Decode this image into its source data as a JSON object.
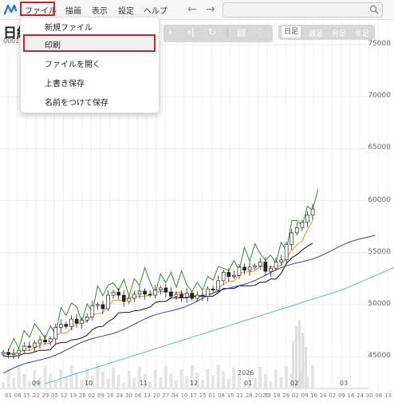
{
  "menubar": {
    "items": [
      {
        "label": "ファイル"
      },
      {
        "label": "描画"
      },
      {
        "label": "表示"
      },
      {
        "label": "設定"
      },
      {
        "label": "ヘルプ"
      }
    ],
    "back_icon": "arrow-left-icon",
    "forward_icon": "arrow-right-icon",
    "search_placeholder": ""
  },
  "symbol": {
    "title": "日経",
    "code": "0001"
  },
  "toolbar": {
    "icons": [
      "chevron-right-icon",
      "skip-to-end-icon",
      "refresh-icon",
      "list-panel-icon",
      "favorite-add-icon"
    ]
  },
  "period_buttons": [
    {
      "label": "日足",
      "active": true
    },
    {
      "label": "週足",
      "active": false
    },
    {
      "label": "月足",
      "active": false
    },
    {
      "label": "年足",
      "active": false
    }
  ],
  "file_menu": {
    "items": [
      {
        "label": "新規ファイル"
      },
      {
        "label": "印刷",
        "highlighted": true
      },
      {
        "label": "ファイルを開く"
      },
      {
        "label": "上書き保存"
      },
      {
        "label": "名前をつけて保存"
      }
    ]
  },
  "colors": {
    "highlight": "#d0202a",
    "candle": "#222222",
    "conversion_line": "#f08c28",
    "base_line": "#111111",
    "lagging_span": "#2e8b2e",
    "leading_span_a": "#5ab4e6",
    "leading_span_b": "#3a3ab0"
  },
  "chart_data": {
    "type": "candlestick",
    "overlay": "ichimoku",
    "y_ticks": [
      45000,
      50000,
      55000,
      60000,
      65000,
      70000,
      75000
    ],
    "ylim": [
      43000,
      76000
    ],
    "x_tick_labels": [
      "01",
      "08",
      "15",
      "22",
      "29",
      "05",
      "12",
      "19",
      "26",
      "02",
      "09",
      "16",
      "24",
      "30",
      "06",
      "13",
      "20",
      "27",
      "04",
      "10",
      "17",
      "25",
      "01",
      "08",
      "15",
      "21",
      "28",
      "2025",
      "13",
      "19",
      "26",
      "02",
      "09",
      "16",
      "24",
      "02",
      "09",
      "16",
      "24",
      "30",
      "06",
      "13"
    ],
    "month_labels": [
      "09",
      "10",
      "11",
      "12",
      "2026",
      "01",
      "02",
      "03"
    ],
    "closes": [
      45400,
      45200,
      45300,
      45600,
      46000,
      45900,
      46300,
      46600,
      46400,
      46700,
      47800,
      48100,
      47900,
      48600,
      48200,
      48500,
      48800,
      49900,
      50000,
      49600,
      50900,
      51200,
      50900,
      50300,
      50600,
      51000,
      51300,
      51000,
      50900,
      51400,
      51600,
      51200,
      50800,
      51000,
      50700,
      51100,
      50600,
      50900,
      50800,
      51500,
      51400,
      52300,
      53100,
      52700,
      52800,
      53600,
      53300,
      53600,
      53700,
      54100,
      53200,
      53500,
      54100,
      54300,
      55800,
      56900,
      57400,
      57900,
      58600,
      59200
    ],
    "volume_note": "bars near bottom of chart"
  }
}
